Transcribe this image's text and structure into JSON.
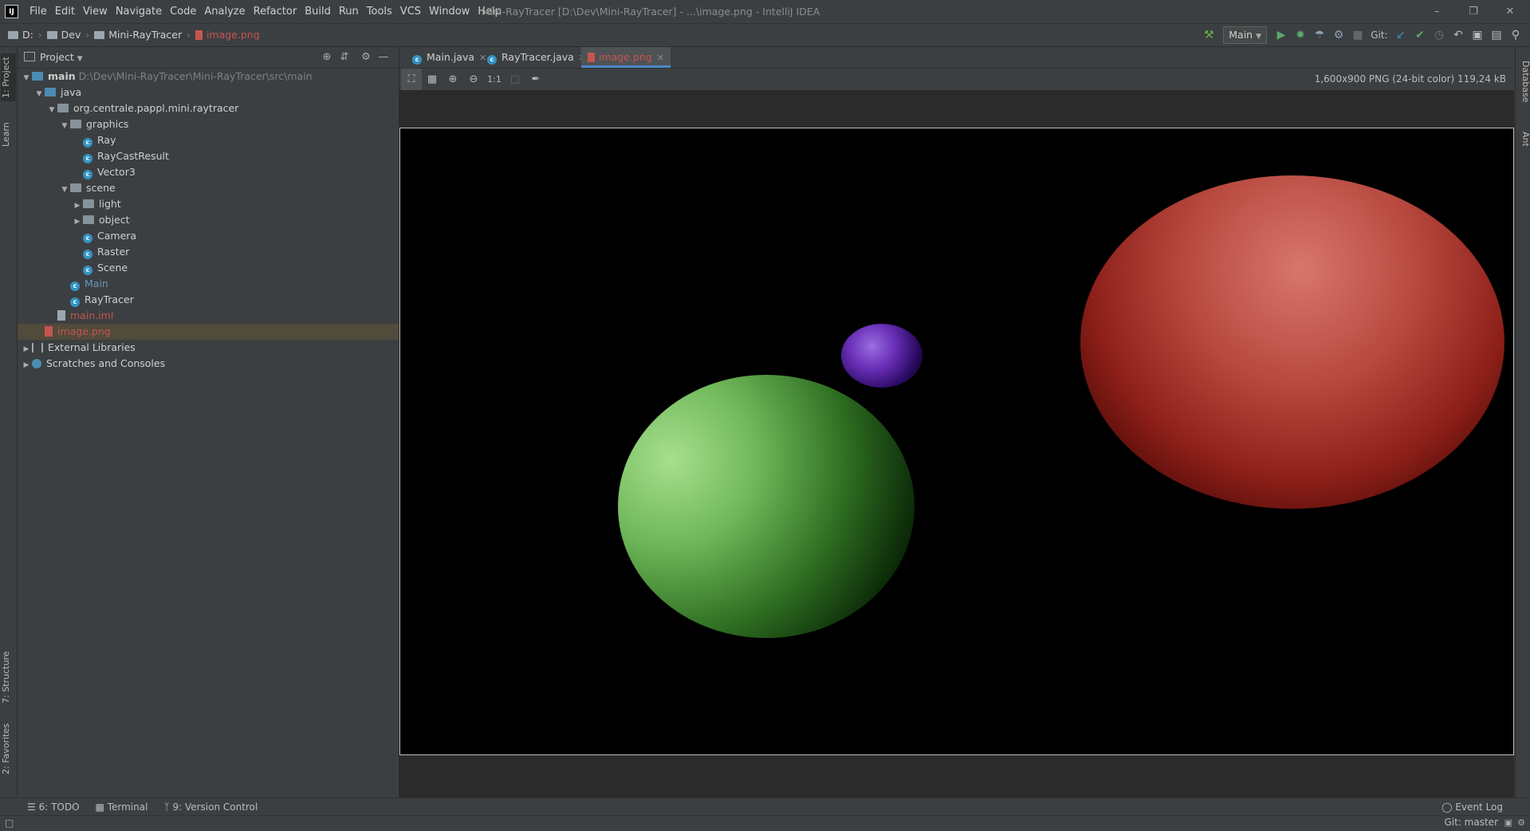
{
  "window": {
    "title": "Mini-RayTracer [D:\\Dev\\Mini-RayTracer] - ...\\image.png - IntelliJ IDEA",
    "logo_text": "IJ",
    "minimize_icon": "minimize-icon",
    "maximize_icon": "restore-icon",
    "close_icon": "close-icon"
  },
  "menu": [
    "File",
    "Edit",
    "View",
    "Navigate",
    "Code",
    "Analyze",
    "Refactor",
    "Build",
    "Run",
    "Tools",
    "VCS",
    "Window",
    "Help"
  ],
  "breadcrumbs": [
    "D:",
    "Dev",
    "Mini-RayTracer",
    "image.png"
  ],
  "toolbar": {
    "run_config": "Main",
    "git_label": "Git:"
  },
  "left_strip": {
    "project_tab": "1: Project",
    "learn_tab": "Learn",
    "structure_tab": "7: Structure",
    "favorites_tab": "2: Favorites"
  },
  "right_strip": {
    "database_tab": "Database",
    "ant_tab": "Ant"
  },
  "project_panel": {
    "title": "Project",
    "tree": [
      {
        "label": "main",
        "extra": "D:\\Dev\\Mini-RayTracer\\Mini-RayTracer\\src\\main",
        "depth": 0,
        "expanded": true,
        "icon": "source-folder-icon"
      },
      {
        "label": "java",
        "depth": 1,
        "expanded": true,
        "icon": "source-folder-icon"
      },
      {
        "label": "org.centrale.pappl.mini.raytracer",
        "depth": 2,
        "expanded": true,
        "icon": "package-icon"
      },
      {
        "label": "graphics",
        "depth": 3,
        "expanded": true,
        "icon": "package-icon"
      },
      {
        "label": "Ray",
        "depth": 4,
        "icon": "class-icon"
      },
      {
        "label": "RayCastResult",
        "depth": 4,
        "icon": "class-icon"
      },
      {
        "label": "Vector3",
        "depth": 4,
        "icon": "class-icon"
      },
      {
        "label": "scene",
        "depth": 3,
        "expanded": true,
        "icon": "package-icon"
      },
      {
        "label": "light",
        "depth": 4,
        "expanded": false,
        "icon": "package-icon"
      },
      {
        "label": "object",
        "depth": 4,
        "expanded": false,
        "icon": "package-icon"
      },
      {
        "label": "Camera",
        "depth": 4,
        "icon": "class-icon"
      },
      {
        "label": "Raster",
        "depth": 4,
        "icon": "class-icon"
      },
      {
        "label": "Scene",
        "depth": 4,
        "icon": "class-icon"
      },
      {
        "label": "Main",
        "depth": 3,
        "icon": "class-icon",
        "color": "blue"
      },
      {
        "label": "RayTracer",
        "depth": 3,
        "icon": "class-icon"
      },
      {
        "label": "main.iml",
        "depth": 2,
        "icon": "file-icon",
        "color": "red"
      },
      {
        "label": "image.png",
        "depth": 1,
        "icon": "image-file-icon",
        "color": "red",
        "selected": true
      },
      {
        "label": "External Libraries",
        "depth": 0,
        "expanded": false,
        "icon": "library-icon"
      },
      {
        "label": "Scratches and Consoles",
        "depth": 0,
        "expanded": false,
        "icon": "scratch-icon"
      }
    ]
  },
  "tabs": [
    {
      "label": "Main.java",
      "active": false
    },
    {
      "label": "RayTracer.java",
      "active": false
    },
    {
      "label": "image.png",
      "active": true
    }
  ],
  "image_viewer": {
    "info": "1,600x900 PNG (24-bit color) 119,24 kB",
    "zoom_ratio_label": "1:1"
  },
  "bottom_tools": [
    "6: TODO",
    "Terminal",
    "9: Version Control"
  ],
  "event_log": "Event Log",
  "status": {
    "git_branch": "Git: master"
  },
  "colors": {
    "accent": "#4a88c7",
    "sphere_red": "#b3382f",
    "sphere_green": "#5fae4a",
    "sphere_purple": "#6a2fb8"
  }
}
